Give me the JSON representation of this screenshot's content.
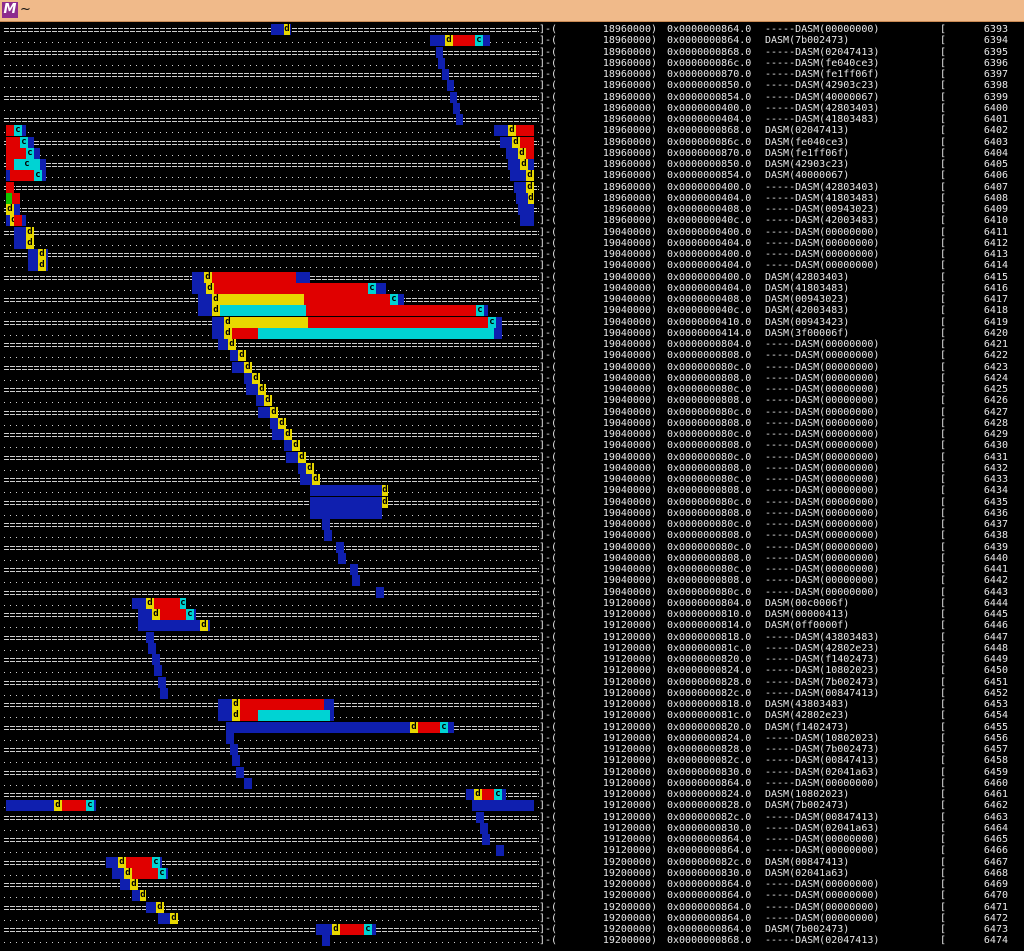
{
  "window": {
    "title": "~",
    "app_icon_letter": "M"
  },
  "colors": {
    "blue": "#0f1faf",
    "red": "#e00000",
    "cyan": "#00d3d3",
    "yellow": "#e8d800",
    "green": "#13c300",
    "text": "#e8e8e8"
  },
  "rows": [
    {
      "c": "18960000)",
      "p": "0x0000000864.0",
      "d": "-----DASM(00000000)",
      "n": "6393"
    },
    {
      "c": "18960000)",
      "p": "0x0000000864.0",
      "d": "DASM(7b002473)",
      "n": "6394"
    },
    {
      "c": "18960000)",
      "p": "0x0000000868.0",
      "d": "-----DASM(02047413)",
      "n": "6395"
    },
    {
      "c": "18960000)",
      "p": "0x000000086c.0",
      "d": "-----DASM(fe040ce3)",
      "n": "6396"
    },
    {
      "c": "18960000)",
      "p": "0x0000000870.0",
      "d": "-----DASM(fe1ff06f)",
      "n": "6397"
    },
    {
      "c": "18960000)",
      "p": "0x0000000850.0",
      "d": "-----DASM(42903c23)",
      "n": "6398"
    },
    {
      "c": "18960000)",
      "p": "0x0000000854.0",
      "d": "-----DASM(40000067)",
      "n": "6399"
    },
    {
      "c": "18960000)",
      "p": "0x0000000400.0",
      "d": "-----DASM(42803403)",
      "n": "6400"
    },
    {
      "c": "18960000)",
      "p": "0x0000000404.0",
      "d": "-----DASM(41803483)",
      "n": "6401"
    },
    {
      "c": "18960000)",
      "p": "0x0000000868.0",
      "d": "DASM(02047413)",
      "n": "6402"
    },
    {
      "c": "18960000)",
      "p": "0x000000086c.0",
      "d": "DASM(fe040ce3)",
      "n": "6403"
    },
    {
      "c": "18960000)",
      "p": "0x0000000870.0",
      "d": "DASM(fe1ff06f)",
      "n": "6404"
    },
    {
      "c": "18960000)",
      "p": "0x0000000850.0",
      "d": "DASM(42903c23)",
      "n": "6405"
    },
    {
      "c": "18960000)",
      "p": "0x0000000854.0",
      "d": "DASM(40000067)",
      "n": "6406"
    },
    {
      "c": "18960000)",
      "p": "0x0000000400.0",
      "d": "-----DASM(42803403)",
      "n": "6407"
    },
    {
      "c": "18960000)",
      "p": "0x0000000404.0",
      "d": "-----DASM(41803483)",
      "n": "6408"
    },
    {
      "c": "18960000)",
      "p": "0x0000000408.0",
      "d": "-----DASM(00943023)",
      "n": "6409"
    },
    {
      "c": "18960000)",
      "p": "0x000000040c.0",
      "d": "-----DASM(42003483)",
      "n": "6410"
    },
    {
      "c": "19040000)",
      "p": "0x0000000400.0",
      "d": "-----DASM(00000000)",
      "n": "6411"
    },
    {
      "c": "19040000)",
      "p": "0x0000000404.0",
      "d": "-----DASM(00000000)",
      "n": "6412"
    },
    {
      "c": "19040000)",
      "p": "0x0000000400.0",
      "d": "-----DASM(00000000)",
      "n": "6413"
    },
    {
      "c": "19040000)",
      "p": "0x0000000404.0",
      "d": "-----DASM(00000000)",
      "n": "6414"
    },
    {
      "c": "19040000)",
      "p": "0x0000000400.0",
      "d": "DASM(42803403)",
      "n": "6415"
    },
    {
      "c": "19040000)",
      "p": "0x0000000404.0",
      "d": "DASM(41803483)",
      "n": "6416"
    },
    {
      "c": "19040000)",
      "p": "0x0000000408.0",
      "d": "DASM(00943023)",
      "n": "6417"
    },
    {
      "c": "19040000)",
      "p": "0x000000040c.0",
      "d": "DASM(42003483)",
      "n": "6418"
    },
    {
      "c": "19040000)",
      "p": "0x0000000410.0",
      "d": "DASM(00943423)",
      "n": "6419"
    },
    {
      "c": "19040000)",
      "p": "0x0000000414.0",
      "d": "DASM(3f00006f)",
      "n": "6420"
    },
    {
      "c": "19040000)",
      "p": "0x0000000804.0",
      "d": "-----DASM(00000000)",
      "n": "6421"
    },
    {
      "c": "19040000)",
      "p": "0x0000000808.0",
      "d": "-----DASM(00000000)",
      "n": "6422"
    },
    {
      "c": "19040000)",
      "p": "0x000000080c.0",
      "d": "-----DASM(00000000)",
      "n": "6423"
    },
    {
      "c": "19040000)",
      "p": "0x0000000808.0",
      "d": "-----DASM(00000000)",
      "n": "6424"
    },
    {
      "c": "19040000)",
      "p": "0x000000080c.0",
      "d": "-----DASM(00000000)",
      "n": "6425"
    },
    {
      "c": "19040000)",
      "p": "0x0000000808.0",
      "d": "-----DASM(00000000)",
      "n": "6426"
    },
    {
      "c": "19040000)",
      "p": "0x000000080c.0",
      "d": "-----DASM(00000000)",
      "n": "6427"
    },
    {
      "c": "19040000)",
      "p": "0x0000000808.0",
      "d": "-----DASM(00000000)",
      "n": "6428"
    },
    {
      "c": "19040000)",
      "p": "0x000000080c.0",
      "d": "-----DASM(00000000)",
      "n": "6429"
    },
    {
      "c": "19040000)",
      "p": "0x0000000808.0",
      "d": "-----DASM(00000000)",
      "n": "6430"
    },
    {
      "c": "19040000)",
      "p": "0x000000080c.0",
      "d": "-----DASM(00000000)",
      "n": "6431"
    },
    {
      "c": "19040000)",
      "p": "0x0000000808.0",
      "d": "-----DASM(00000000)",
      "n": "6432"
    },
    {
      "c": "19040000)",
      "p": "0x000000080c.0",
      "d": "-----DASM(00000000)",
      "n": "6433"
    },
    {
      "c": "19040000)",
      "p": "0x0000000808.0",
      "d": "-----DASM(00000000)",
      "n": "6434"
    },
    {
      "c": "19040000)",
      "p": "0x000000080c.0",
      "d": "-----DASM(00000000)",
      "n": "6435"
    },
    {
      "c": "19040000)",
      "p": "0x0000000808.0",
      "d": "-----DASM(00000000)",
      "n": "6436"
    },
    {
      "c": "19040000)",
      "p": "0x000000080c.0",
      "d": "-----DASM(00000000)",
      "n": "6437"
    },
    {
      "c": "19040000)",
      "p": "0x0000000808.0",
      "d": "-----DASM(00000000)",
      "n": "6438"
    },
    {
      "c": "19040000)",
      "p": "0x000000080c.0",
      "d": "-----DASM(00000000)",
      "n": "6439"
    },
    {
      "c": "19040000)",
      "p": "0x0000000808.0",
      "d": "-----DASM(00000000)",
      "n": "6440"
    },
    {
      "c": "19040000)",
      "p": "0x000000080c.0",
      "d": "-----DASM(00000000)",
      "n": "6441"
    },
    {
      "c": "19040000)",
      "p": "0x0000000808.0",
      "d": "-----DASM(00000000)",
      "n": "6442"
    },
    {
      "c": "19040000)",
      "p": "0x000000080c.0",
      "d": "-----DASM(00000000)",
      "n": "6443"
    },
    {
      "c": "19120000)",
      "p": "0x0000000804.0",
      "d": "DASM(00c0006f)",
      "n": "6444"
    },
    {
      "c": "19120000)",
      "p": "0x0000000810.0",
      "d": "DASM(00000413)",
      "n": "6445"
    },
    {
      "c": "19120000)",
      "p": "0x0000000814.0",
      "d": "DASM(0ff0000f)",
      "n": "6446"
    },
    {
      "c": "19120000)",
      "p": "0x0000000818.0",
      "d": "-----DASM(43803483)",
      "n": "6447"
    },
    {
      "c": "19120000)",
      "p": "0x000000081c.0",
      "d": "-----DASM(42802e23)",
      "n": "6448"
    },
    {
      "c": "19120000)",
      "p": "0x0000000820.0",
      "d": "-----DASM(f1402473)",
      "n": "6449"
    },
    {
      "c": "19120000)",
      "p": "0x0000000824.0",
      "d": "-----DASM(10802023)",
      "n": "6450"
    },
    {
      "c": "19120000)",
      "p": "0x0000000828.0",
      "d": "-----DASM(7b002473)",
      "n": "6451"
    },
    {
      "c": "19120000)",
      "p": "0x000000082c.0",
      "d": "-----DASM(00847413)",
      "n": "6452"
    },
    {
      "c": "19120000)",
      "p": "0x0000000818.0",
      "d": "DASM(43803483)",
      "n": "6453"
    },
    {
      "c": "19120000)",
      "p": "0x000000081c.0",
      "d": "DASM(42802e23)",
      "n": "6454"
    },
    {
      "c": "19120000)",
      "p": "0x0000000820.0",
      "d": "DASM(f1402473)",
      "n": "6455"
    },
    {
      "c": "19120000)",
      "p": "0x0000000824.0",
      "d": "-----DASM(10802023)",
      "n": "6456"
    },
    {
      "c": "19120000)",
      "p": "0x0000000828.0",
      "d": "-----DASM(7b002473)",
      "n": "6457"
    },
    {
      "c": "19120000)",
      "p": "0x000000082c.0",
      "d": "-----DASM(00847413)",
      "n": "6458"
    },
    {
      "c": "19120000)",
      "p": "0x0000000830.0",
      "d": "-----DASM(02041a63)",
      "n": "6459"
    },
    {
      "c": "19120000)",
      "p": "0x0000000864.0",
      "d": "-----DASM(00000000)",
      "n": "6460"
    },
    {
      "c": "19120000)",
      "p": "0x0000000824.0",
      "d": "DASM(10802023)",
      "n": "6461"
    },
    {
      "c": "19120000)",
      "p": "0x0000000828.0",
      "d": "DASM(7b002473)",
      "n": "6462"
    },
    {
      "c": "19120000)",
      "p": "0x000000082c.0",
      "d": "-----DASM(00847413)",
      "n": "6463"
    },
    {
      "c": "19120000)",
      "p": "0x0000000830.0",
      "d": "-----DASM(02041a63)",
      "n": "6464"
    },
    {
      "c": "19120000)",
      "p": "0x0000000864.0",
      "d": "-----DASM(00000000)",
      "n": "6465"
    },
    {
      "c": "19120000)",
      "p": "0x0000000864.0",
      "d": "-----DASM(00000000)",
      "n": "6466"
    },
    {
      "c": "19200000)",
      "p": "0x000000082c.0",
      "d": "DASM(00847413)",
      "n": "6467"
    },
    {
      "c": "19200000)",
      "p": "0x0000000830.0",
      "d": "DASM(02041a63)",
      "n": "6468"
    },
    {
      "c": "19200000)",
      "p": "0x0000000864.0",
      "d": "-----DASM(00000000)",
      "n": "6469"
    },
    {
      "c": "19200000)",
      "p": "0x0000000864.0",
      "d": "-----DASM(00000000)",
      "n": "6470"
    },
    {
      "c": "19200000)",
      "p": "0x0000000864.0",
      "d": "-----DASM(00000000)",
      "n": "6471"
    },
    {
      "c": "19200000)",
      "p": "0x0000000864.0",
      "d": "-----DASM(00000000)",
      "n": "6472"
    },
    {
      "c": "19200000)",
      "p": "0x0000000864.0",
      "d": "DASM(7b002473)",
      "n": "6473"
    },
    {
      "c": "19200000)",
      "p": "0x0000000868.0",
      "d": "-----DASM(02047413)",
      "n": "6474"
    }
  ],
  "stage_letters": [
    "d",
    "c"
  ],
  "line_tail": "]-(",
  "bracket": "["
}
